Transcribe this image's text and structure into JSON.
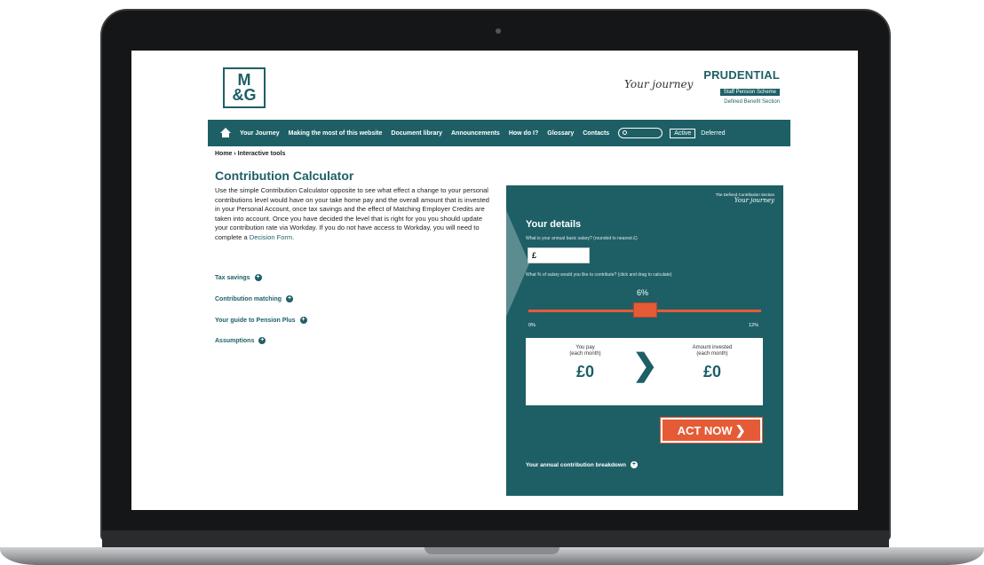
{
  "header": {
    "logo_text_line1": "M",
    "logo_text_line2": "&G",
    "journey_script": "Your journey",
    "brand": "PRUDENTIAL",
    "badge": "Staff Pension Scheme",
    "section": "Defined Benefit Section"
  },
  "nav": {
    "items": [
      "Your Journey",
      "Making the most of this website",
      "Document library",
      "Announcements",
      "How do I?",
      "Glossary",
      "Contacts"
    ],
    "active_label": "Active",
    "deferred_label": "Deferred"
  },
  "breadcrumb": "Home › Interactive tools",
  "main": {
    "title": "Contribution Calculator",
    "intro_part1": "Use the simple Contribution Calculator opposite to see what effect a change to your personal contributions level would have on your take home pay and the overall amount that is invested in your Personal Account, once tax savings and the effect of Matching Employer Credits are taken into account. Once you have decided the level that is right for you you should update your contribution rate via Workday. If you do not have access to Workday, you will need to complete a ",
    "intro_link": "Decision Form.",
    "sections": [
      "Tax savings",
      "Contribution matching",
      "Your guide to Pension Plus",
      "Assumptions"
    ]
  },
  "calculator": {
    "top_line1": "The Defined Contribution Section",
    "top_line2": "Your journey",
    "title": "Your details",
    "salary_question": "What is your annual basic salary? (rounded to nearest £)",
    "salary_value": "£",
    "percent_question": "What % of salary would you like to contribute? (click and drag to calculate)",
    "slider_value": "6%",
    "slider_fraction": 0.5,
    "slider_min": "0%",
    "slider_max": "12%",
    "you_pay_label": "You pay\n(each month)",
    "you_pay_value": "£0",
    "invested_label": "Amount invested\n(each month)",
    "invested_value": "£0",
    "act_now": "ACT NOW",
    "breakdown": "Your annual contribution breakdown"
  },
  "colors": {
    "teal": "#1e5f66",
    "orange": "#e55b36"
  }
}
